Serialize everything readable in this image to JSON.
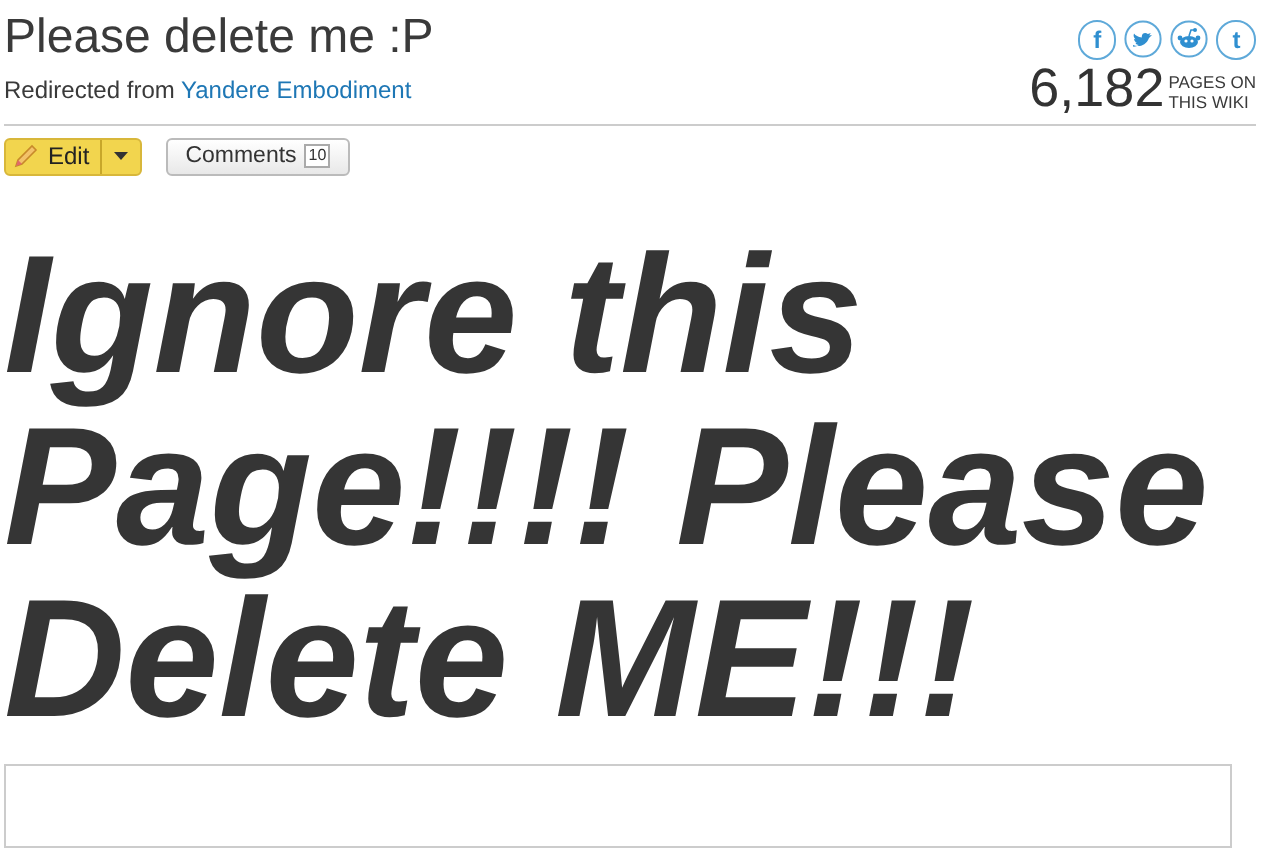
{
  "header": {
    "title": "Please delete me :P",
    "redirect_prefix": "Redirected from",
    "redirect_link": "Yandere Embodiment"
  },
  "social": [
    {
      "kind": "facebook",
      "glyph": "f"
    },
    {
      "kind": "twitter"
    },
    {
      "kind": "reddit"
    },
    {
      "kind": "tumblr",
      "glyph": "t"
    }
  ],
  "page_count": {
    "number": "6,182",
    "label_1": "PAGES ON",
    "label_2": "THIS WIKI"
  },
  "actions": {
    "edit": "Edit",
    "comments": "Comments",
    "comment_count": "10"
  },
  "body": {
    "heading": "Ignore this Page!!!! Please Delete ME!!!"
  }
}
